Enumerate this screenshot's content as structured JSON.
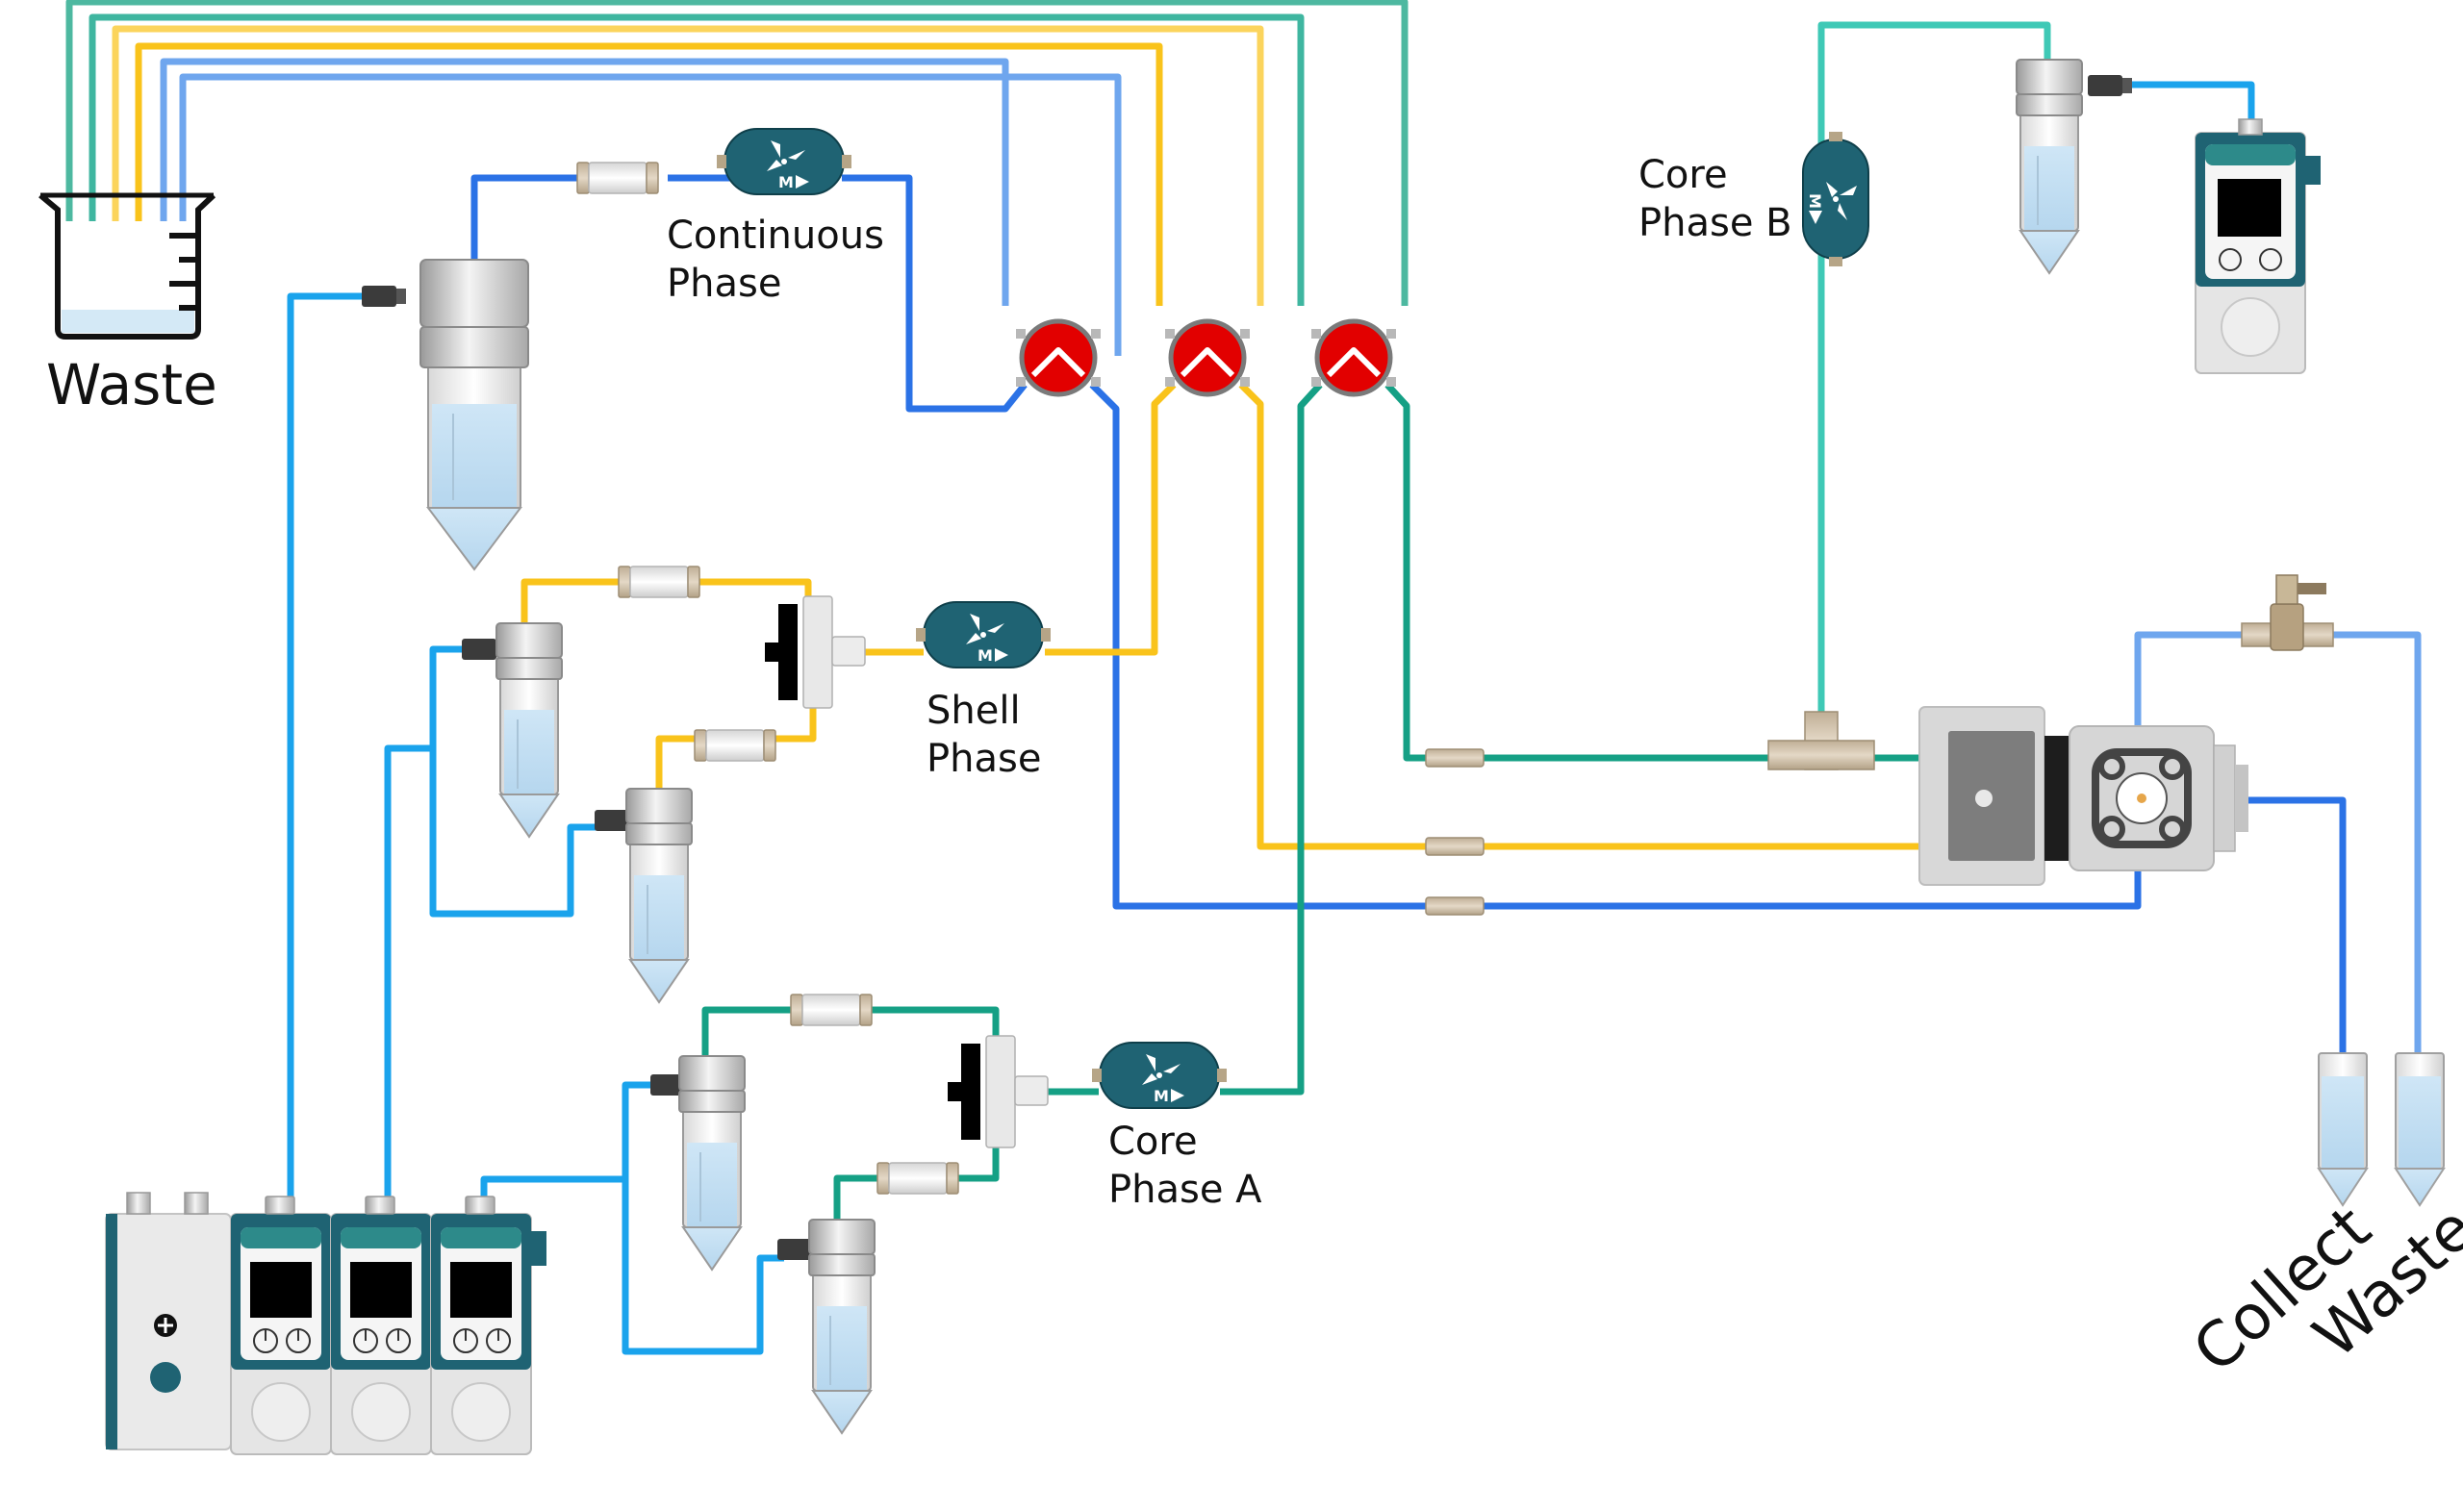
{
  "labels": {
    "waste_top": "Waste",
    "continuous_phase": [
      "Continuous",
      "Phase"
    ],
    "shell_phase": [
      "Shell",
      "Phase"
    ],
    "core_phase_a": [
      "Core",
      "Phase A"
    ],
    "core_phase_b": [
      "Core",
      "Phase B"
    ],
    "collect": "Collect",
    "waste_outlet": "Waste"
  },
  "flow_sensor_text": "M",
  "colors": {
    "tube_blue_dark": "#2B72E6",
    "tube_blue_light": "#6FA6EE",
    "tube_sky": "#1AA3EC",
    "tube_yellow": "#F9C31B",
    "tube_yellow_light": "#FBD45C",
    "tube_green": "#15A085",
    "tube_teal": "#3FC9B6",
    "tube_seagreen": "#4DB8A0",
    "valve_red": "#E20000",
    "device_teal": "#1F6373",
    "fitting_tan": "#C9B9A2",
    "reservoir_grey": "#CFCFCF"
  }
}
